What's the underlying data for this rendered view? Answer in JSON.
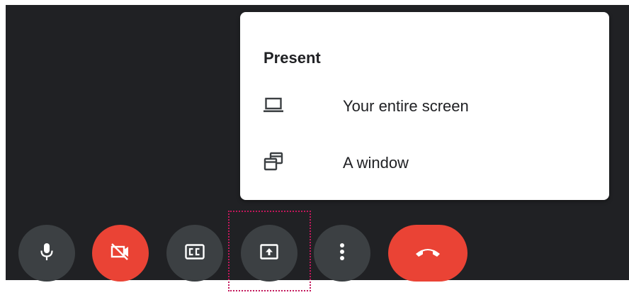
{
  "present_menu": {
    "title": "Present",
    "items": [
      {
        "label": "Your entire screen",
        "icon": "laptop-icon"
      },
      {
        "label": "A window",
        "icon": "window-icon"
      }
    ]
  },
  "controls": [
    {
      "name": "mic-button",
      "icon": "microphone-icon"
    },
    {
      "name": "camera-off-button",
      "icon": "camera-off-icon",
      "color": "#ea4335"
    },
    {
      "name": "captions-button",
      "icon": "closed-captions-icon"
    },
    {
      "name": "present-button",
      "icon": "present-screen-icon",
      "focused": true
    },
    {
      "name": "more-options-button",
      "icon": "more-vertical-icon"
    },
    {
      "name": "leave-call-button",
      "icon": "hang-up-icon",
      "color": "#ea4335"
    }
  ],
  "colors": {
    "background": "#202124",
    "button": "#3c4043",
    "danger": "#ea4335",
    "focus_ring": "#c2185b",
    "menu_surface": "#ffffff"
  }
}
